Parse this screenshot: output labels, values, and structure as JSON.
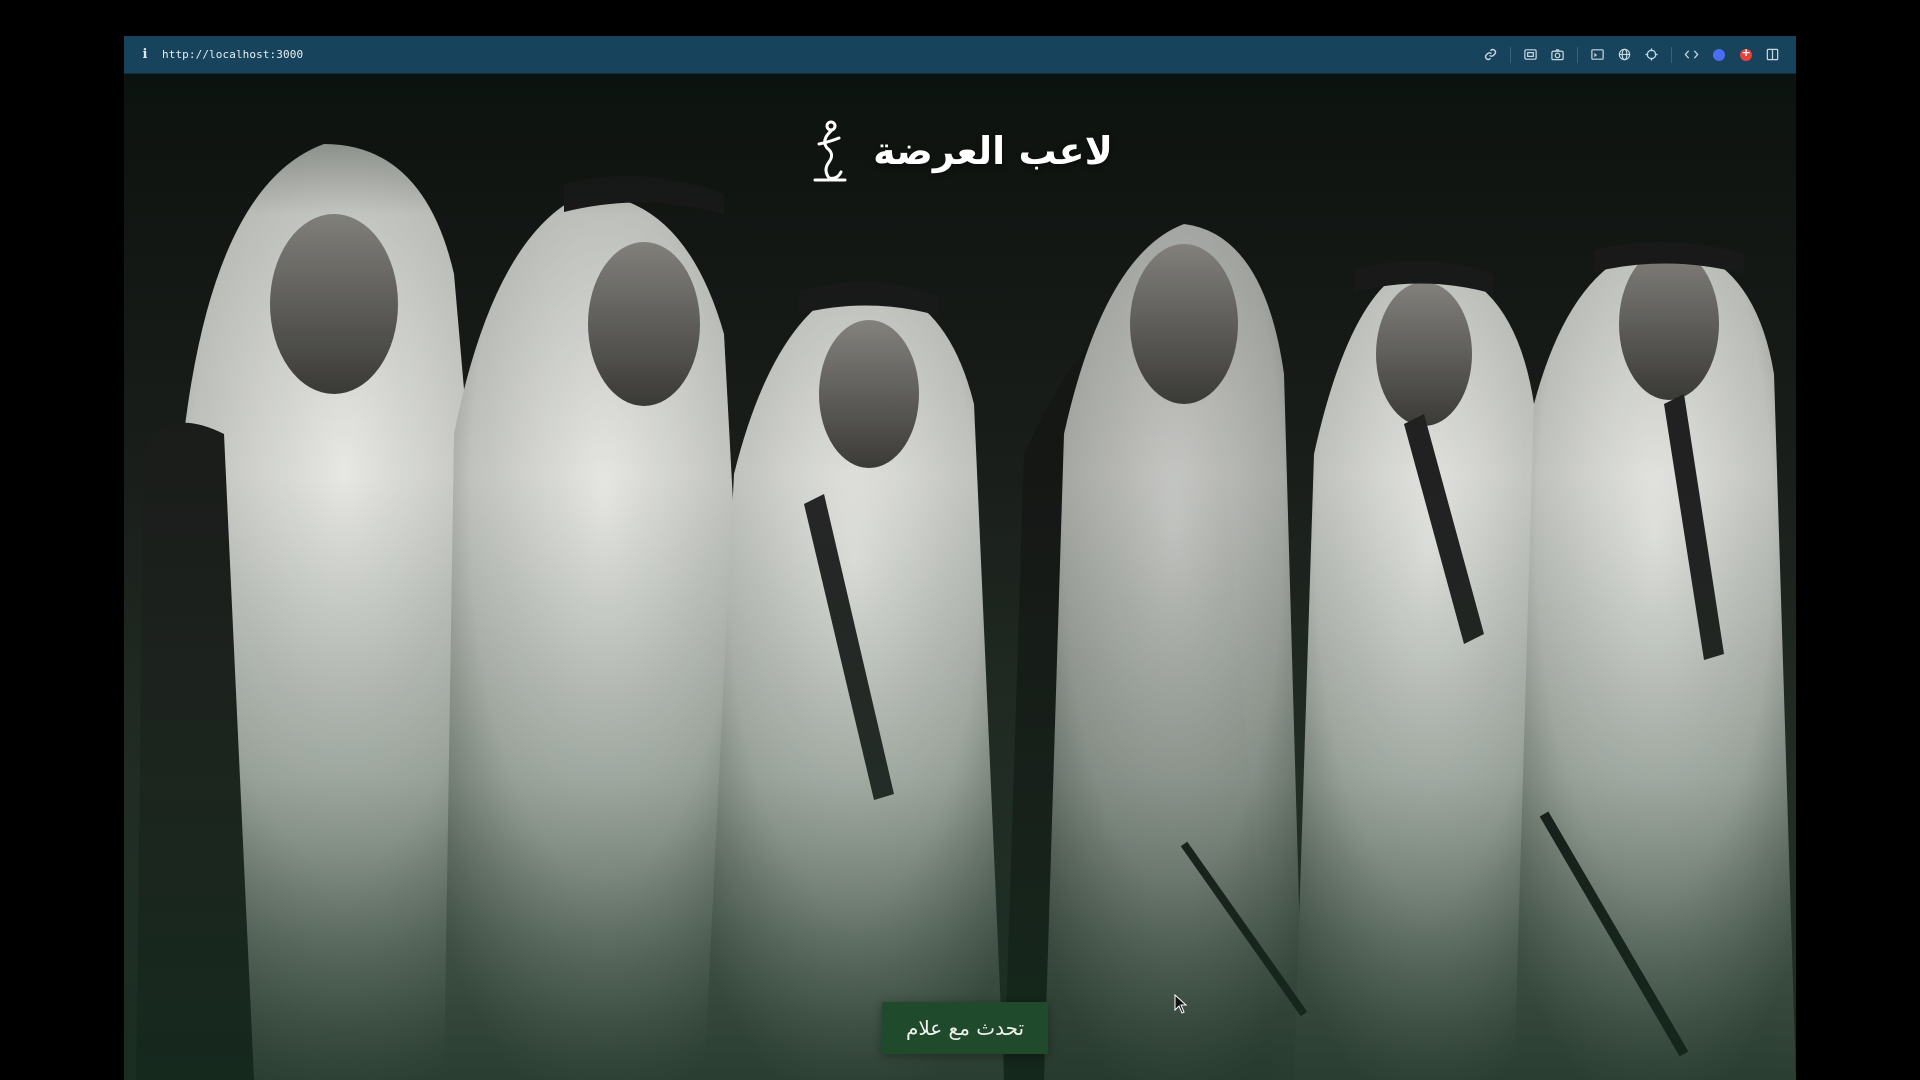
{
  "browser": {
    "url": "http://localhost:3000",
    "info_icon": "info-icon",
    "toolbar_icons": [
      "link-icon",
      "screenshot-icon",
      "camera-icon",
      "terminal-icon",
      "globe-icon",
      "crosshair-icon",
      "code-icon",
      "extension-icon",
      "record-icon",
      "sidebar-icon"
    ]
  },
  "hero": {
    "title": "لاعب العرضة",
    "logo_icon": "dancer-logo-icon",
    "background": "black-and-white photograph of men in traditional Saudi dress performing the ardah sword dance",
    "cta_label": "تحدث مع علام"
  },
  "colors": {
    "toolbar": "#17445c",
    "cta_background": "#1f4a2b",
    "title_text": "#ffffff"
  }
}
